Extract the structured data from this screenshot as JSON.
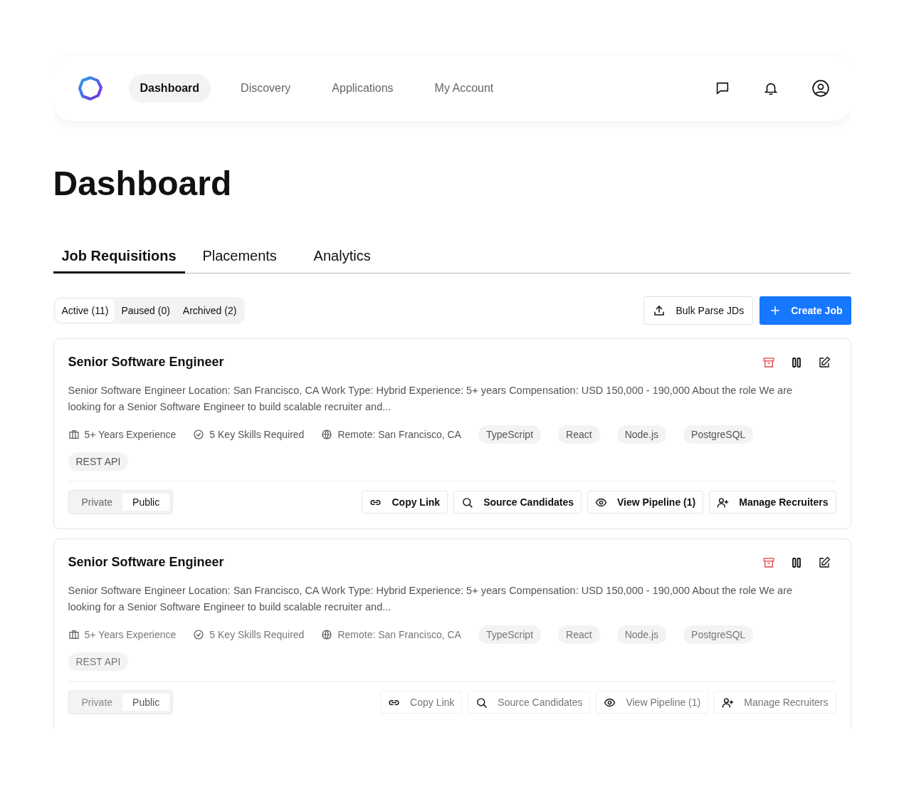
{
  "nav": {
    "items": [
      {
        "label": "Dashboard",
        "selected": true
      },
      {
        "label": "Discovery",
        "selected": false
      },
      {
        "label": "Applications",
        "selected": false
      },
      {
        "label": "My Account",
        "selected": false
      }
    ]
  },
  "page_title": "Dashboard",
  "tabs": [
    {
      "label": "Job Requisitions",
      "selected": true
    },
    {
      "label": "Placements",
      "selected": false
    },
    {
      "label": "Analytics",
      "selected": false
    }
  ],
  "filters": [
    {
      "label": "Active (11)",
      "selected": true
    },
    {
      "label": "Paused (0)",
      "selected": false
    },
    {
      "label": "Archived (2)",
      "selected": false
    }
  ],
  "toolbar": {
    "bulk_button": "Bulk Parse JDs",
    "create_button": "Create Job"
  },
  "jobs": [
    {
      "title": "Senior Software Engineer",
      "description": "Senior Software Engineer Location: San Francisco, CA Work Type: Hybrid Experience: 5+ years Compensation: USD 150,000 - 190,000 About the role We are looking for a Senior Software Engineer to build scalable recruiter and...",
      "faded": false,
      "meta": [
        {
          "kind": "experience",
          "text": "5+ Years Experience"
        },
        {
          "kind": "skills",
          "text": "5 Key Skills Required"
        },
        {
          "kind": "location",
          "text": "Remote: San Francisco, CA"
        }
      ],
      "tags": [
        "TypeScript",
        "React",
        "Node.js",
        "PostgreSQL",
        "REST API"
      ],
      "visibility": [
        {
          "label": "Private",
          "selected": false
        },
        {
          "label": "Public",
          "selected": true
        }
      ],
      "actions": [
        {
          "kind": "link",
          "label": "Copy Link"
        },
        {
          "kind": "search",
          "label": "Source Candidates"
        },
        {
          "kind": "eye",
          "label": "View Pipeline (1)"
        },
        {
          "kind": "user-add",
          "label": "Manage Recruiters"
        }
      ]
    },
    {
      "title": "Senior Software Engineer",
      "description": "Senior Software Engineer Location: San Francisco, CA Work Type: Hybrid Experience: 5+ years Compensation: USD 150,000 - 190,000 About the role We are looking for a Senior Software Engineer to build scalable recruiter and...",
      "faded": true,
      "meta": [
        {
          "kind": "experience",
          "text": "5+ Years Experience"
        },
        {
          "kind": "skills",
          "text": "5 Key Skills Required"
        },
        {
          "kind": "location",
          "text": "Remote: San Francisco, CA"
        }
      ],
      "tags": [
        "TypeScript",
        "React",
        "Node.js",
        "PostgreSQL",
        "REST API"
      ],
      "visibility": [
        {
          "label": "Private",
          "selected": false
        },
        {
          "label": "Public",
          "selected": true
        }
      ],
      "actions": [
        {
          "kind": "link",
          "label": "Copy Link"
        },
        {
          "kind": "search",
          "label": "Source Candidates"
        },
        {
          "kind": "eye",
          "label": "View Pipeline (1)"
        },
        {
          "kind": "user-add",
          "label": "Manage Recruiters"
        }
      ]
    }
  ]
}
